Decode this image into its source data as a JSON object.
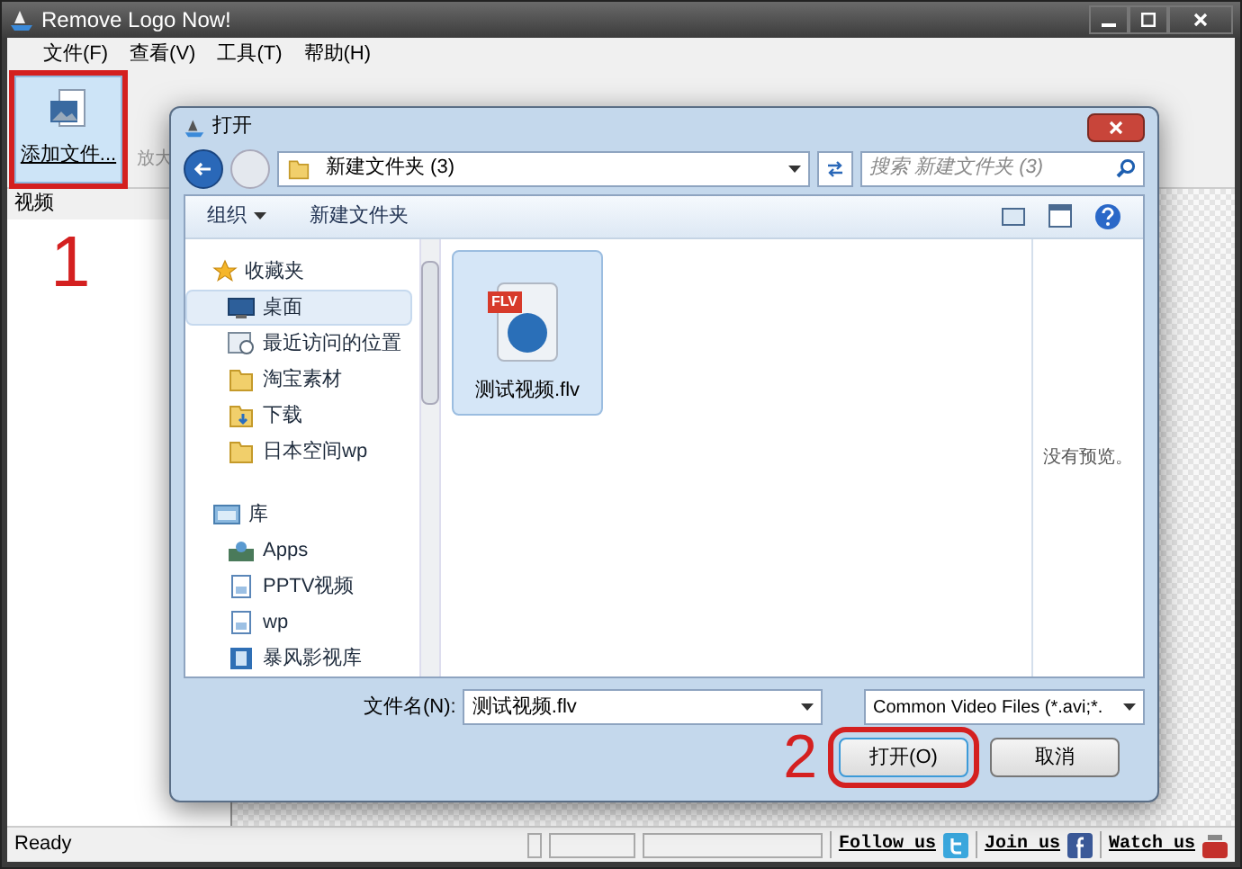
{
  "window": {
    "title": "Remove Logo Now!"
  },
  "menu": [
    "文件(F)",
    "查看(V)",
    "工具(T)",
    "帮助(H)"
  ],
  "toolbar": {
    "add_button": {
      "label": "添加文件...",
      "highlighted": true
    },
    "partial_label": "放大"
  },
  "left_panel": {
    "header": "视频"
  },
  "annotations": [
    {
      "text": "1"
    },
    {
      "text": "2"
    }
  ],
  "dialog": {
    "title": "打开",
    "breadcrumb": "新建文件夹 (3)",
    "search": {
      "placeholder": "搜索 新建文件夹 (3)"
    },
    "commands": [
      {
        "label": "组织",
        "dropdown": true
      },
      {
        "label": "新建文件夹",
        "dropdown": false
      }
    ],
    "nav": [
      {
        "label": "收藏夹",
        "kind": "group",
        "selected": false,
        "children": [
          {
            "label": "桌面",
            "kind": "desktop",
            "selected": true
          },
          {
            "label": "最近访问的位置",
            "kind": "recent",
            "selected": false
          },
          {
            "label": "淘宝素材",
            "kind": "folder",
            "selected": false
          },
          {
            "label": "下载",
            "kind": "download",
            "selected": false
          },
          {
            "label": "日本空间wp",
            "kind": "folder",
            "selected": false
          }
        ]
      },
      {
        "label": "库",
        "kind": "library",
        "selected": false,
        "children": [
          {
            "label": "Apps",
            "kind": "apps",
            "selected": false
          },
          {
            "label": "PPTV视频",
            "kind": "doc",
            "selected": false
          },
          {
            "label": "wp",
            "kind": "doc",
            "selected": false
          },
          {
            "label": "暴风影视库",
            "kind": "film",
            "selected": false
          }
        ]
      }
    ],
    "files": [
      {
        "name": "测试视频.flv",
        "badge": "FLV",
        "selected": true
      }
    ],
    "preview_text": "没有预览。",
    "filename": {
      "label": "文件名(N):",
      "value": "测试视频.flv"
    },
    "filter": "Common Video Files (*.avi;*.",
    "buttons": [
      {
        "label": "打开(O)",
        "default": true
      },
      {
        "label": "取消",
        "default": false
      }
    ]
  },
  "status_bar": {
    "text": "Ready",
    "links": [
      {
        "label": "Follow us",
        "kind": "twitter"
      },
      {
        "label": "Join us",
        "kind": "facebook"
      },
      {
        "label": "Watch us",
        "kind": "youtube"
      }
    ]
  }
}
